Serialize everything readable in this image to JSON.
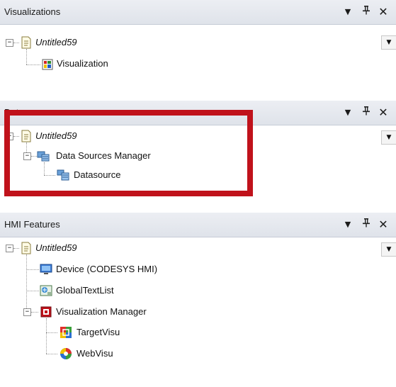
{
  "panes": {
    "visualizations": {
      "title": "Visualizations",
      "root": "Untitled59",
      "items": [
        "Visualization"
      ]
    },
    "datasources": {
      "title": "Datasources",
      "root": "Untitled59",
      "manager": "Data Sources Manager",
      "items": [
        "Datasource"
      ]
    },
    "hmi": {
      "title": "HMI Features",
      "root": "Untitled59",
      "device": "Device (CODESYS HMI)",
      "textlist": "GlobalTextList",
      "manager": "Visualization Manager",
      "items": [
        "TargetVisu",
        "WebVisu"
      ]
    }
  },
  "buttons": {
    "menu": "▼",
    "pin": "ꟸ",
    "close": "✕",
    "scroll": "▼",
    "collapse": "−"
  },
  "colors": {
    "highlight": "#c0121b",
    "header_bg": "#e3e7ee"
  },
  "icons": [
    "project-file-icon",
    "visualization-icon",
    "datasource-manager-icon",
    "datasource-icon",
    "device-icon",
    "text-list-icon",
    "visualization-manager-icon",
    "target-visu-icon",
    "web-visu-icon"
  ]
}
